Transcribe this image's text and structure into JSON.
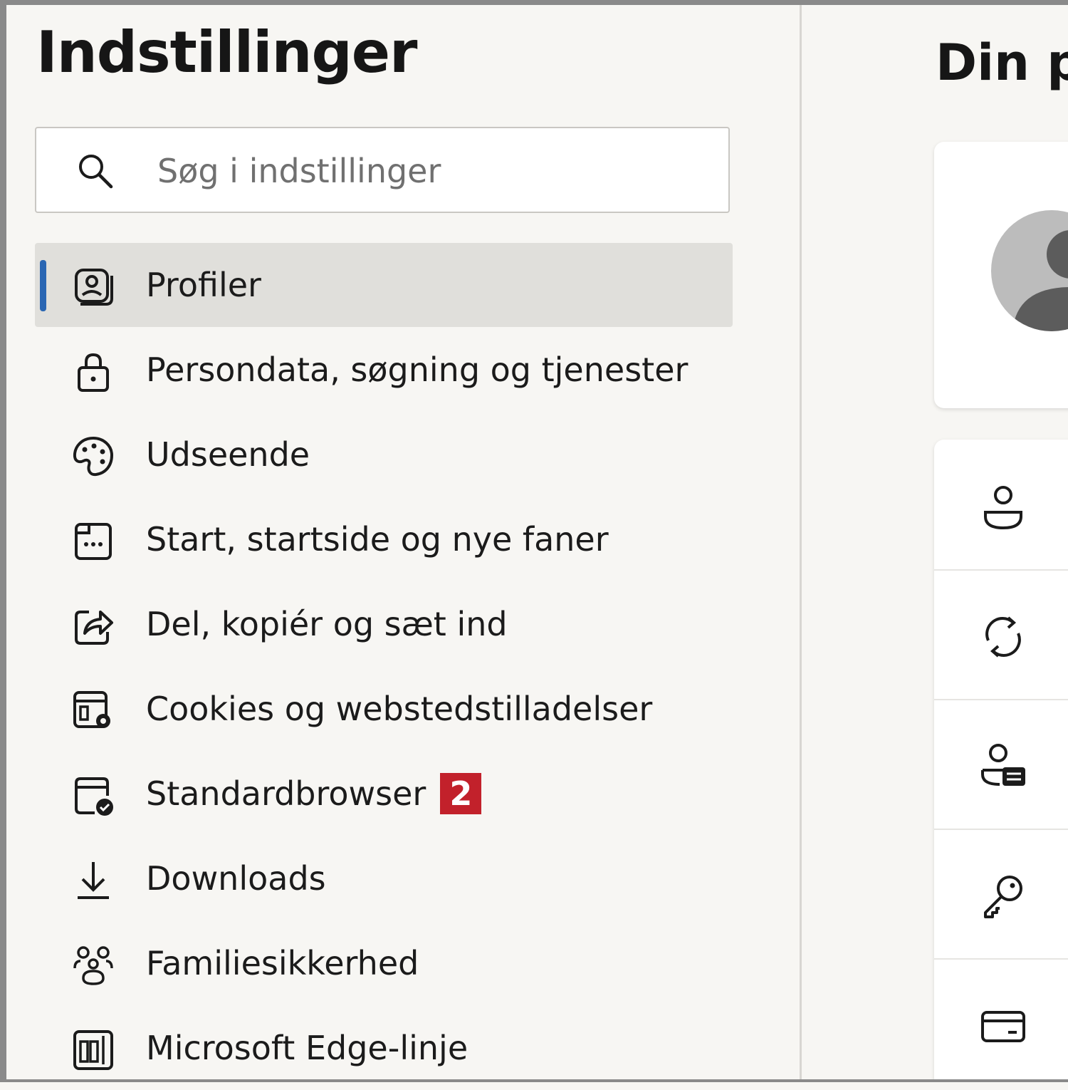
{
  "settings": {
    "title": "Indstillinger",
    "search": {
      "placeholder": "Søg i indstillinger",
      "value": ""
    },
    "nav": [
      {
        "label": "Profiler",
        "icon": "profile-icon",
        "active": true
      },
      {
        "label": "Persondata, søgning og tjenester",
        "icon": "lock-icon"
      },
      {
        "label": "Udseende",
        "icon": "palette-icon"
      },
      {
        "label": "Start, startside og nye faner",
        "icon": "new-tab-icon"
      },
      {
        "label": "Del, kopiér og sæt ind",
        "icon": "share-icon"
      },
      {
        "label": "Cookies og webstedstilladelser",
        "icon": "site-settings-icon"
      },
      {
        "label": "Standardbrowser",
        "icon": "default-browser-icon",
        "badge": "2"
      },
      {
        "label": "Downloads",
        "icon": "download-icon"
      },
      {
        "label": "Familiesikkerhed",
        "icon": "family-icon"
      },
      {
        "label": "Microsoft Edge-linje",
        "icon": "sidebar-bar-icon"
      }
    ]
  },
  "main": {
    "title": "Din p",
    "profile_card": {
      "icon": "avatar-icon"
    },
    "rows": [
      {
        "icon": "person-icon"
      },
      {
        "icon": "sync-icon"
      },
      {
        "icon": "personal-info-icon"
      },
      {
        "icon": "key-icon"
      },
      {
        "icon": "card-icon"
      }
    ]
  },
  "colors": {
    "background": "#f7f6f3",
    "active_item": "#e0dfdb",
    "accent": "#2a66b3",
    "badge": "#c2212b"
  }
}
